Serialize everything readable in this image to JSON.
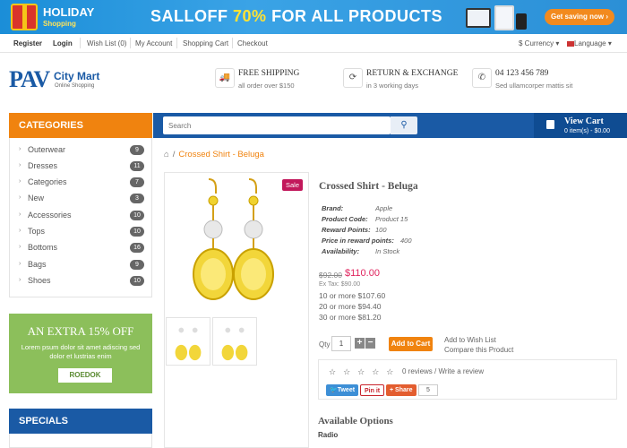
{
  "banner": {
    "holiday": "HOLIDAY",
    "shopping": "Shopping",
    "sale_prefix": "SALLOFF",
    "sale_percent": "70%",
    "sale_suffix": "FOR ALL PRODUCTS",
    "cta": "Get saving now",
    "colors": {
      "background": "#2b95dc",
      "cta": "#f28a1e",
      "percent": "#ffe234"
    }
  },
  "topnav": {
    "register": "Register",
    "login": "Login",
    "wishlist": "Wish List (0)",
    "account": "My Account",
    "cart": "Shopping Cart",
    "checkout": "Checkout",
    "currency": "$ Currency",
    "language": "Language"
  },
  "logo": {
    "pav": "PAV",
    "name": "City Mart",
    "tagline": "Online Shopping"
  },
  "features": [
    {
      "icon": "truck-icon",
      "title": "FREE SHIPPING",
      "desc": "all order over $150"
    },
    {
      "icon": "refresh-icon",
      "title": "RETURN & EXCHANGE",
      "desc": "in 3 working days"
    },
    {
      "icon": "phone-icon",
      "title": "04 123 456 789",
      "desc": "Sed ullamcorper mattis sit"
    }
  ],
  "categories": {
    "title": "CATEGORIES",
    "items": [
      {
        "label": "Outerwear",
        "count": "9"
      },
      {
        "label": "Dresses",
        "count": "11"
      },
      {
        "label": "Categories",
        "count": "7"
      },
      {
        "label": "New",
        "count": "3"
      },
      {
        "label": "Accessories",
        "count": "10"
      },
      {
        "label": "Tops",
        "count": "10"
      },
      {
        "label": "Bottoms",
        "count": "16"
      },
      {
        "label": "Bags",
        "count": "9"
      },
      {
        "label": "Shoes",
        "count": "10"
      }
    ]
  },
  "promo": {
    "heading": "AN EXTRA 15% OFF",
    "text": "Lorem psum dolor sit amet adiscing sed dolor et lustrias enim",
    "button": "ROEDOK"
  },
  "specials": {
    "title": "SPECIALS"
  },
  "search": {
    "placeholder": "Search"
  },
  "cart": {
    "title": "View Cart",
    "info": "0 item(s) - $0.00"
  },
  "breadcrumb": {
    "current": "Crossed Shirt - Beluga"
  },
  "product": {
    "sale_badge": "Sale",
    "name": "Crossed Shirt - Beluga",
    "attributes": [
      {
        "k": "Brand:",
        "v": "Apple"
      },
      {
        "k": "Product Code:",
        "v": "Product 15"
      },
      {
        "k": "Reward Points:",
        "v": "100"
      },
      {
        "k": "Price in reward points:",
        "v": "400"
      },
      {
        "k": "Availability:",
        "v": "In Stock"
      }
    ],
    "old_price": "$92.00",
    "new_price": "$110.00",
    "ex_tax": "Ex Tax: $90.00",
    "tiers": [
      "10 or more $107.60",
      "20 or more $94.40",
      "30 or more $81.20"
    ],
    "qty_label": "Qty",
    "qty_value": "1",
    "add_to_cart": "Add to Cart",
    "add_to_wishlist": "Add to Wish List",
    "compare": "Compare this Product",
    "reviews": "0 reviews / Write a review",
    "tweet": "Tweet",
    "pinit": "Pin it",
    "share": "Share",
    "share_count": "5",
    "options_title": "Available Options",
    "options_radio": "Radio"
  }
}
